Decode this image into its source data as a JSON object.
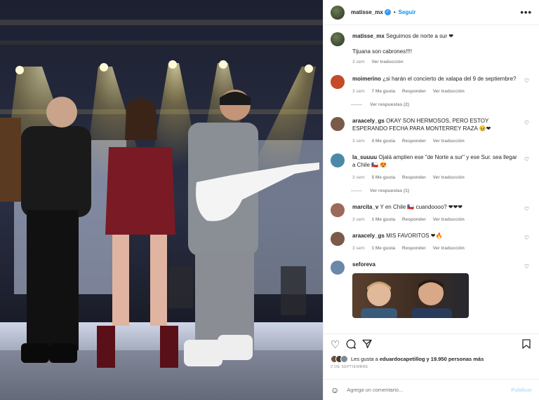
{
  "post": {
    "username": "matisse_mx",
    "verified_mark": "✓",
    "follow_label": "Seguir",
    "more_label": "•••"
  },
  "caption": {
    "username": "matisse_mx",
    "line1": "Seguimos de norte a sur ❤",
    "line2": "Tijuana son cabrones!!!!",
    "time": "3 sem",
    "translate": "Ver traducción"
  },
  "comments": [
    {
      "username": "moimerino",
      "text": "¿si harán el concierto de xalapa del 9 de septiembre?",
      "time": "3 sem",
      "likes": "7 Me gusta",
      "reply": "Responder",
      "translate": "Ver traducción",
      "replies": "Ver respuestas (2)",
      "avatar_color": "#c44a2a"
    },
    {
      "username": "araacely_gs",
      "text": "OKAY SON HERMOSOS, PERO ESTOY ESPERANDO FECHA PARA MONTERREY RAZA 🥹❤",
      "time": "3 sem",
      "likes": "4 Me gusta",
      "reply": "Responder",
      "translate": "Ver traducción",
      "replies": "",
      "avatar_color": "#7a5a48"
    },
    {
      "username": "la_suuuu",
      "text": "Ojalá amplien ese \"de Norte a sur\" y ese Sur. sea llegar a Chile 🇨🇱 😍",
      "time": "3 sem",
      "likes": "5 Me gusta",
      "reply": "Responder",
      "translate": "Ver traducción",
      "replies": "Ver respuestas (1)",
      "avatar_color": "#4a8aa8"
    },
    {
      "username": "marcita_v",
      "text": "Y en Chile 🇨🇱 cuandoooo? ❤❤❤",
      "time": "3 sem",
      "likes": "1 Me gusta",
      "reply": "Responder",
      "translate": "Ver traducción",
      "replies": "",
      "avatar_color": "#9a6a5a"
    },
    {
      "username": "araacely_gs",
      "text": "MIS FAVORITOS ❤🔥",
      "time": "3 sem",
      "likes": "1 Me gusta",
      "reply": "Responder",
      "translate": "Ver traducción",
      "replies": "",
      "avatar_color": "#7a5a48"
    },
    {
      "username": "seforeva",
      "text": "",
      "time": "",
      "likes": "",
      "reply": "",
      "translate": "",
      "replies": "",
      "avatar_color": "#6a88a8"
    }
  ],
  "actions": {
    "like_icon": "heart-icon",
    "comment_icon": "comment-icon",
    "share_icon": "share-icon",
    "save_icon": "bookmark-icon"
  },
  "likes": {
    "text_prefix": "Les gusta a ",
    "user": "eduardocapetillog",
    "text_suffix": " y 19.950 personas más"
  },
  "date": "2 DE SEPTIEMBRE",
  "add_comment": {
    "placeholder": "Agrega un comentario...",
    "publish": "Publicar"
  },
  "colors": {
    "accent": "#0095f6",
    "muted": "#8e8e8e",
    "publish_disabled": "#b2dffc"
  }
}
